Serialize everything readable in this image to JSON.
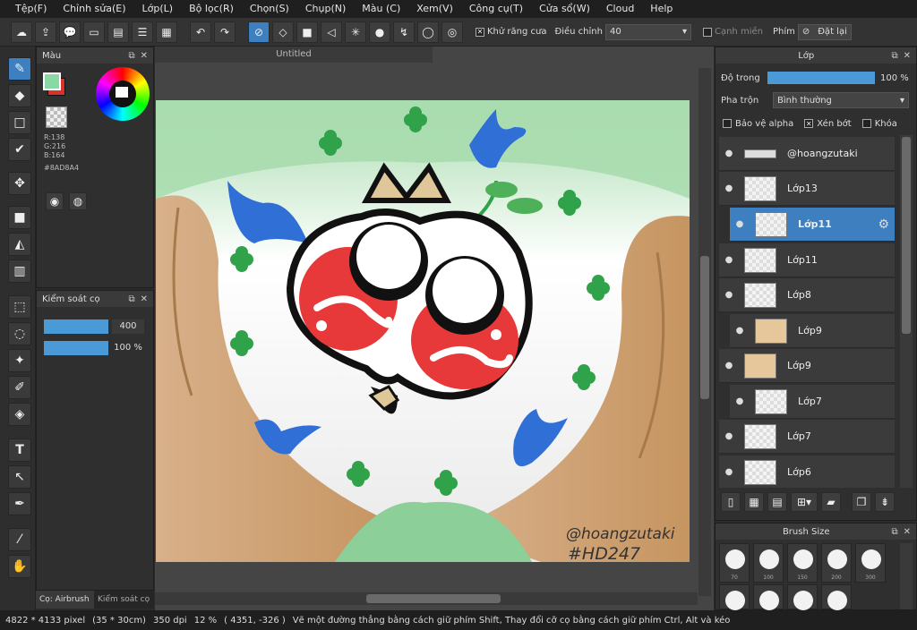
{
  "menu": [
    "Tệp(F)",
    "Chỉnh sửa(E)",
    "Lớp(L)",
    "Bộ lọc(R)",
    "Chọn(S)",
    "Chụp(N)",
    "Màu (C)",
    "Xem(V)",
    "Công cụ(T)",
    "Cửa sổ(W)",
    "Cloud",
    "Help"
  ],
  "toolbar": {
    "antialias_label": "Khử răng cưa",
    "correction_label": "Điều chỉnh",
    "correction_value": "40",
    "snap_label": "Cạnh miền",
    "key_label": "Phím",
    "reset_label": "Đặt lại"
  },
  "color_panel": {
    "title": "Màu",
    "r": "R:138",
    "g": "G:216",
    "b": "B:164",
    "hex": "#8AD8A4",
    "fg_color": "#8AD8A4",
    "bg_color": "#d9322b"
  },
  "brush_control": {
    "title": "Kiểm soát cọ",
    "size_value": "400",
    "opacity_value": "100 %"
  },
  "left_tabs": [
    "Cọ: Airbrush",
    "Kiểm soát cọ"
  ],
  "document": {
    "tab_title": "Untitled"
  },
  "artwork": {
    "watermark_name": "@hoangzutaki",
    "watermark_tag": "#HD247"
  },
  "layer_panel": {
    "title": "Lớp",
    "opacity_label": "Độ trong",
    "opacity_value": "100 %",
    "blend_label": "Pha trộn",
    "blend_value": "Bình thường",
    "protect_alpha_label": "Bảo vệ alpha",
    "clipping_label": "Xén bớt",
    "lock_label": "Khóa",
    "layers": [
      {
        "name": "@hoangzutaki"
      },
      {
        "name": "Lớp13"
      },
      {
        "name": "Lớp11",
        "selected": true
      },
      {
        "name": "Lớp11"
      },
      {
        "name": "Lớp8"
      },
      {
        "name": "Lớp9"
      },
      {
        "name": "Lớp9"
      },
      {
        "name": "Lớp7"
      },
      {
        "name": "Lớp7"
      },
      {
        "name": "Lớp6"
      }
    ]
  },
  "brush_size": {
    "title": "Brush Size",
    "sizes": [
      "70",
      "100",
      "150",
      "200",
      "300"
    ]
  },
  "status": {
    "dimensions": "4822 * 4133 pixel",
    "cm": "(35 * 30cm)",
    "dpi": "350 dpi",
    "zoom": "12 %",
    "coords": "( 4351, -326 )",
    "hint": "Vẽ một đường thẳng bằng cách giữ phím Shift, Thay đổi cỡ cọ bằng cách giữ phím Ctrl, Alt và kéo"
  }
}
